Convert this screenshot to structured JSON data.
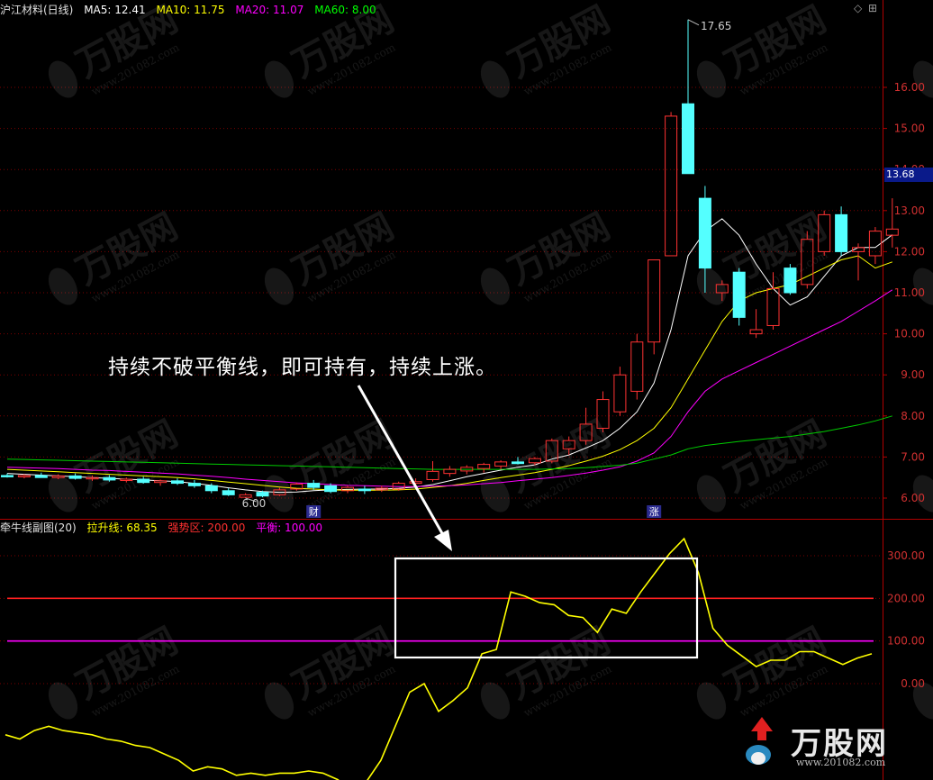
{
  "main_header": {
    "title": "沪江材料(日线)",
    "ma5": "MA5: 12.41",
    "ma10": "MA10: 11.75",
    "ma20": "MA20: 11.07",
    "ma60": "MA60: 8.00"
  },
  "sub_header": {
    "title": "牵牛线副图(20)",
    "line1": "拉升线: 68.35",
    "line2": "强势区: 200.00",
    "line3": "平衡: 100.00"
  },
  "controls": {
    "diamond": "◇",
    "grid": "⊞"
  },
  "annotation": "持续不破平衡线，即可持有，持续上涨。",
  "price_tag": "13.68",
  "markers": {
    "cai": "财",
    "zhang": "涨"
  },
  "watermark": {
    "brand": "万股网",
    "url": "www.201082.com"
  },
  "colors": {
    "up": "#ff3232",
    "down": "#54ffff",
    "ma5": "#ffffff",
    "ma10": "#ffff00",
    "ma20": "#ff00ff",
    "ma60": "#00cc00",
    "grid": "#7a0000",
    "strong": "#ff2020",
    "balance": "#ff00ff",
    "pull": "#ffff00"
  },
  "chart_data": [
    {
      "type": "candlestick",
      "title": "沪江材料(日线)",
      "y_ticks": [
        6.0,
        7.0,
        8.0,
        9.0,
        10.0,
        11.0,
        12.0,
        13.0,
        14.0,
        15.0,
        16.0
      ],
      "ylim": [
        5.6,
        17.7
      ],
      "annotations": {
        "high": "17.65",
        "low": "6.00",
        "last": "13.68"
      },
      "candles": [
        {
          "o": 6.55,
          "h": 6.6,
          "l": 6.5,
          "c": 6.52
        },
        {
          "o": 6.52,
          "h": 6.58,
          "l": 6.48,
          "c": 6.55
        },
        {
          "o": 6.55,
          "h": 6.62,
          "l": 6.5,
          "c": 6.5
        },
        {
          "o": 6.5,
          "h": 6.58,
          "l": 6.46,
          "c": 6.54
        },
        {
          "o": 6.54,
          "h": 6.6,
          "l": 6.45,
          "c": 6.48
        },
        {
          "o": 6.48,
          "h": 6.55,
          "l": 6.42,
          "c": 6.5
        },
        {
          "o": 6.5,
          "h": 6.56,
          "l": 6.4,
          "c": 6.44
        },
        {
          "o": 6.44,
          "h": 6.5,
          "l": 6.38,
          "c": 6.46
        },
        {
          "o": 6.46,
          "h": 6.52,
          "l": 6.35,
          "c": 6.38
        },
        {
          "o": 6.38,
          "h": 6.45,
          "l": 6.3,
          "c": 6.42
        },
        {
          "o": 6.42,
          "h": 6.48,
          "l": 6.32,
          "c": 6.36
        },
        {
          "o": 6.36,
          "h": 6.44,
          "l": 6.25,
          "c": 6.3
        },
        {
          "o": 6.3,
          "h": 6.36,
          "l": 6.12,
          "c": 6.18
        },
        {
          "o": 6.18,
          "h": 6.24,
          "l": 6.05,
          "c": 6.08
        },
        {
          "o": 6.02,
          "h": 6.12,
          "l": 6.0,
          "c": 6.08
        },
        {
          "o": 6.14,
          "h": 6.18,
          "l": 6.02,
          "c": 6.05
        },
        {
          "o": 6.08,
          "h": 6.25,
          "l": 6.05,
          "c": 6.2
        },
        {
          "o": 6.22,
          "h": 6.38,
          "l": 6.18,
          "c": 6.34
        },
        {
          "o": 6.36,
          "h": 6.44,
          "l": 6.2,
          "c": 6.26
        },
        {
          "o": 6.3,
          "h": 6.36,
          "l": 6.12,
          "c": 6.16
        },
        {
          "o": 6.18,
          "h": 6.3,
          "l": 6.12,
          "c": 6.26
        },
        {
          "o": 6.22,
          "h": 6.3,
          "l": 6.1,
          "c": 6.18
        },
        {
          "o": 6.2,
          "h": 6.3,
          "l": 6.15,
          "c": 6.24
        },
        {
          "o": 6.22,
          "h": 6.4,
          "l": 6.18,
          "c": 6.36
        },
        {
          "o": 6.36,
          "h": 6.48,
          "l": 6.25,
          "c": 6.4
        },
        {
          "o": 6.45,
          "h": 6.9,
          "l": 6.4,
          "c": 6.65
        },
        {
          "o": 6.6,
          "h": 6.78,
          "l": 6.52,
          "c": 6.7
        },
        {
          "o": 6.66,
          "h": 6.8,
          "l": 6.58,
          "c": 6.75
        },
        {
          "o": 6.72,
          "h": 6.86,
          "l": 6.62,
          "c": 6.82
        },
        {
          "o": 6.78,
          "h": 6.92,
          "l": 6.7,
          "c": 6.88
        },
        {
          "o": 6.88,
          "h": 7.0,
          "l": 6.82,
          "c": 6.84
        },
        {
          "o": 6.86,
          "h": 7.0,
          "l": 6.8,
          "c": 6.96
        },
        {
          "o": 6.9,
          "h": 7.45,
          "l": 6.85,
          "c": 7.4
        },
        {
          "o": 7.2,
          "h": 7.5,
          "l": 7.05,
          "c": 7.4
        },
        {
          "o": 7.4,
          "h": 8.2,
          "l": 7.3,
          "c": 7.8
        },
        {
          "o": 7.7,
          "h": 8.6,
          "l": 7.6,
          "c": 8.4
        },
        {
          "o": 8.1,
          "h": 9.2,
          "l": 8.0,
          "c": 9.0
        },
        {
          "o": 8.6,
          "h": 10.0,
          "l": 8.4,
          "c": 9.8
        },
        {
          "o": 9.8,
          "h": 11.8,
          "l": 9.5,
          "c": 11.8
        },
        {
          "o": 11.9,
          "h": 15.4,
          "l": 11.9,
          "c": 15.3
        },
        {
          "o": 15.6,
          "h": 17.65,
          "l": 14.0,
          "c": 13.9
        },
        {
          "o": 13.3,
          "h": 13.6,
          "l": 11.0,
          "c": 11.6
        },
        {
          "o": 11.0,
          "h": 11.3,
          "l": 10.8,
          "c": 11.2
        },
        {
          "o": 11.5,
          "h": 11.6,
          "l": 10.2,
          "c": 10.4
        },
        {
          "o": 10.0,
          "h": 10.6,
          "l": 9.9,
          "c": 10.1
        },
        {
          "o": 10.2,
          "h": 11.5,
          "l": 10.1,
          "c": 11.1
        },
        {
          "o": 11.6,
          "h": 11.7,
          "l": 10.95,
          "c": 11.0
        },
        {
          "o": 11.2,
          "h": 12.5,
          "l": 11.1,
          "c": 12.3
        },
        {
          "o": 12.0,
          "h": 13.0,
          "l": 11.9,
          "c": 12.9
        },
        {
          "o": 12.9,
          "h": 13.1,
          "l": 11.9,
          "c": 12.0
        },
        {
          "o": 12.0,
          "h": 12.2,
          "l": 11.3,
          "c": 12.1
        },
        {
          "o": 11.9,
          "h": 12.6,
          "l": 11.7,
          "c": 12.5
        },
        {
          "o": 12.4,
          "h": 13.3,
          "l": 12.1,
          "c": 12.55
        }
      ],
      "series": [
        {
          "name": "MA5",
          "values": [
            6.6,
            6.58,
            6.56,
            6.54,
            6.52,
            6.5,
            6.48,
            6.46,
            6.44,
            6.42,
            6.4,
            6.36,
            6.31,
            6.25,
            6.2,
            6.16,
            6.14,
            6.15,
            6.18,
            6.2,
            6.21,
            6.22,
            6.22,
            6.24,
            6.27,
            6.33,
            6.42,
            6.52,
            6.6,
            6.68,
            6.75,
            6.81,
            6.95,
            7.05,
            7.22,
            7.4,
            7.7,
            8.1,
            8.8,
            10.1,
            11.9,
            12.5,
            12.8,
            12.4,
            11.7,
            11.1,
            10.7,
            10.9,
            11.4,
            11.9,
            12.1,
            12.1,
            12.41
          ]
        },
        {
          "name": "MA10",
          "values": [
            6.7,
            6.68,
            6.66,
            6.64,
            6.62,
            6.6,
            6.58,
            6.56,
            6.54,
            6.52,
            6.5,
            6.47,
            6.43,
            6.39,
            6.35,
            6.31,
            6.27,
            6.24,
            6.22,
            6.2,
            6.19,
            6.19,
            6.19,
            6.2,
            6.22,
            6.26,
            6.3,
            6.36,
            6.43,
            6.5,
            6.56,
            6.62,
            6.7,
            6.79,
            6.9,
            7.02,
            7.18,
            7.4,
            7.7,
            8.2,
            8.9,
            9.6,
            10.3,
            10.8,
            11.0,
            11.1,
            11.2,
            11.4,
            11.6,
            11.8,
            11.9,
            11.6,
            11.75
          ]
        },
        {
          "name": "MA20",
          "values": [
            6.75,
            6.74,
            6.73,
            6.72,
            6.7,
            6.68,
            6.67,
            6.65,
            6.63,
            6.61,
            6.59,
            6.56,
            6.53,
            6.5,
            6.46,
            6.43,
            6.4,
            6.37,
            6.35,
            6.33,
            6.31,
            6.3,
            6.29,
            6.28,
            6.28,
            6.29,
            6.3,
            6.32,
            6.35,
            6.38,
            6.42,
            6.46,
            6.5,
            6.55,
            6.61,
            6.68,
            6.76,
            6.9,
            7.1,
            7.5,
            8.1,
            8.6,
            8.9,
            9.1,
            9.3,
            9.5,
            9.7,
            9.9,
            10.1,
            10.3,
            10.55,
            10.8,
            11.07
          ]
        },
        {
          "name": "MA60",
          "values": [
            6.95,
            6.94,
            6.93,
            6.92,
            6.91,
            6.9,
            6.89,
            6.88,
            6.87,
            6.86,
            6.85,
            6.84,
            6.83,
            6.82,
            6.81,
            6.8,
            6.79,
            6.78,
            6.77,
            6.76,
            6.75,
            6.74,
            6.73,
            6.72,
            6.71,
            6.7,
            6.7,
            6.7,
            6.7,
            6.7,
            6.7,
            6.7,
            6.71,
            6.72,
            6.74,
            6.77,
            6.8,
            6.85,
            6.95,
            7.05,
            7.2,
            7.28,
            7.33,
            7.38,
            7.42,
            7.46,
            7.5,
            7.56,
            7.62,
            7.7,
            7.78,
            7.88,
            8.0
          ]
        }
      ]
    },
    {
      "type": "line",
      "title": "牵牛线副图(20)",
      "y_ticks": [
        0,
        100,
        200,
        300
      ],
      "ylim": [
        -190,
        360
      ],
      "hlines": [
        {
          "name": "强势区",
          "value": 200
        },
        {
          "name": "平衡",
          "value": 100
        }
      ],
      "series": [
        {
          "name": "拉升线",
          "values": [
            -120,
            -130,
            -110,
            -100,
            -110,
            -115,
            -120,
            -130,
            -135,
            -145,
            -150,
            -165,
            -180,
            -205,
            -195,
            -200,
            -215,
            -210,
            -215,
            -210,
            -210,
            -205,
            -210,
            -225,
            -250,
            -230,
            -180,
            -100,
            -20,
            0,
            -65,
            -40,
            -10,
            70,
            80,
            215,
            205,
            190,
            185,
            160,
            155,
            120,
            175,
            165,
            215,
            260,
            305,
            340,
            260,
            130,
            90,
            65,
            40,
            55,
            55,
            75,
            75,
            60,
            45,
            60,
            70
          ]
        }
      ]
    }
  ]
}
